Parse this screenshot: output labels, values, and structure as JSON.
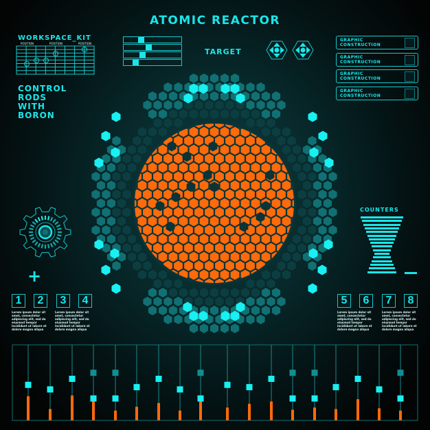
{
  "title": "ATOMIC REACTOR",
  "colors": {
    "accent": "#19e6ea",
    "teal": "#117073",
    "dark_teal": "#0c3e41",
    "orange": "#ff6a0a",
    "background": "#041314"
  },
  "workspace": {
    "title": "WORKSPACE_KIT",
    "position_labels": [
      "POSITION",
      "POSITION",
      "POSITION"
    ]
  },
  "control_rods_label": [
    "CONTROL",
    "RODS",
    "WITH",
    "BORON"
  ],
  "mini_sliders": [
    0.28,
    0.43,
    0.31,
    0.17
  ],
  "target": {
    "label": "TARGET",
    "icons": [
      "dpad-hexagon-icon",
      "dpad-hexagon-icon"
    ]
  },
  "graphic_boxes": [
    {
      "line1": "GRAPHIC",
      "line2": "CONSTRUCTION",
      "checked": false
    },
    {
      "line1": "GRAPHIC",
      "line2": "CONSTRUCTION",
      "checked": false
    },
    {
      "line1": "GRAPHIC",
      "line2": "CONSTRUCTION",
      "checked": false
    },
    {
      "line1": "GRAPHIC",
      "line2": "CONSTRUCTION",
      "checked": false
    }
  ],
  "gear_icon": "gear-icon",
  "plus_label": "+",
  "minus_label": "−",
  "counters": {
    "title": "COUNTERS"
  },
  "numbers_left": [
    "1",
    "2",
    "3",
    "4"
  ],
  "numbers_right": [
    "5",
    "6",
    "7",
    "8"
  ],
  "lorem": "Lorem ipsum dolor sit amet, consectetur adipiscing elit, sed do eiusmod tempor incididunt ut labore et dolore magna aliqua",
  "equalizer": {
    "handles": [
      [
        0.47
      ],
      [
        0.41
      ],
      [
        0.55
      ],
      [
        0.63,
        0.29
      ],
      [
        0.63,
        0.29
      ],
      [
        0.44
      ],
      [
        0.55
      ],
      [
        0.41
      ],
      [
        0.63,
        0.29
      ],
      [
        0.47
      ],
      [
        0.44
      ],
      [
        0.55
      ],
      [
        0.63,
        0.29
      ],
      [
        0.63,
        0.29
      ],
      [
        0.44
      ],
      [
        0.55
      ],
      [
        0.41
      ],
      [
        0.63,
        0.29
      ]
    ],
    "levels": [
      0.32,
      0.15,
      0.33,
      0.25,
      0.13,
      0.18,
      0.23,
      0.13,
      0.25,
      0.17,
      0.22,
      0.25,
      0.14,
      0.17,
      0.15,
      0.28,
      0.16,
      0.13
    ]
  }
}
